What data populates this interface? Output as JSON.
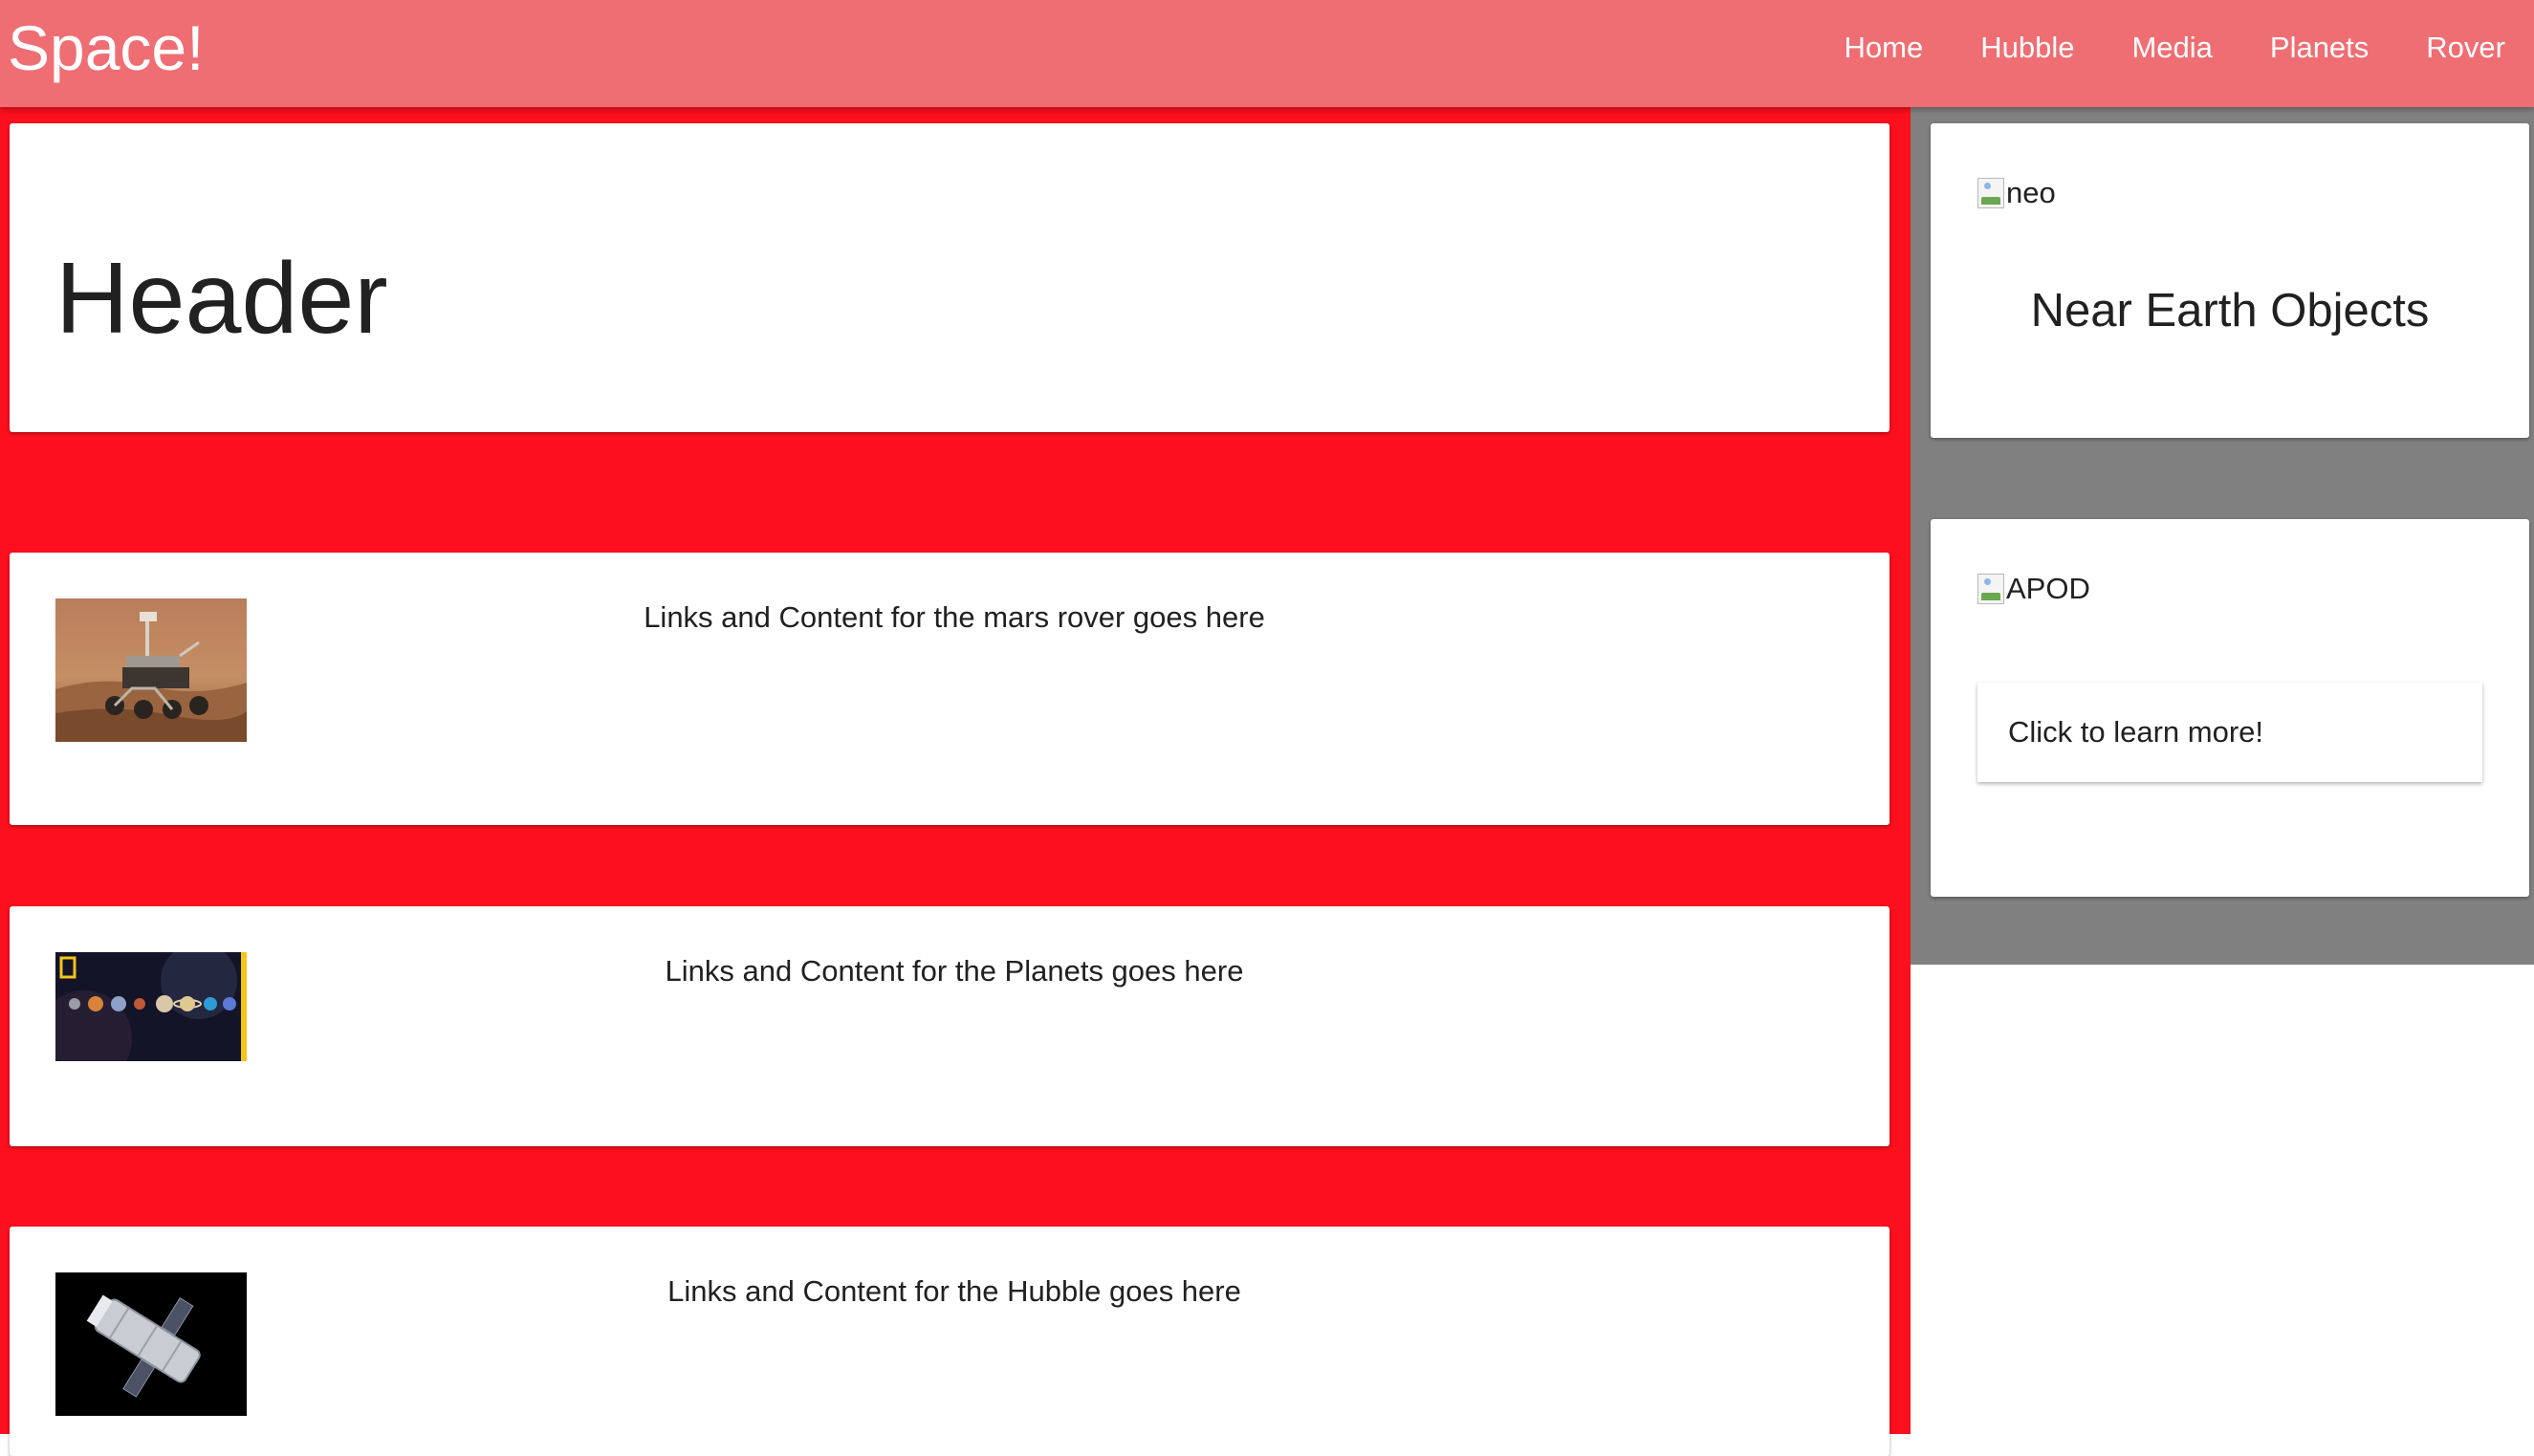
{
  "navbar": {
    "brand": "Space!",
    "links": [
      "Home",
      "Hubble",
      "Media",
      "Planets",
      "Rover"
    ],
    "background": "#ee6e73"
  },
  "main": {
    "background": "#fc101e",
    "header_title": "Header",
    "rows": [
      {
        "image_alt": "mars rover",
        "text": "Links and Content for the mars rover goes here"
      },
      {
        "image_alt": "planets",
        "text": "Links and Content for the Planets goes here"
      },
      {
        "image_alt": "hubble",
        "text": "Links and Content for the Hubble goes here"
      }
    ]
  },
  "sidebar": {
    "background": "#808080",
    "neo_card": {
      "image_alt": "neo",
      "title": "Near Earth Objects"
    },
    "apod_card": {
      "image_alt": "APOD",
      "button_label": "Click to learn more!"
    }
  }
}
